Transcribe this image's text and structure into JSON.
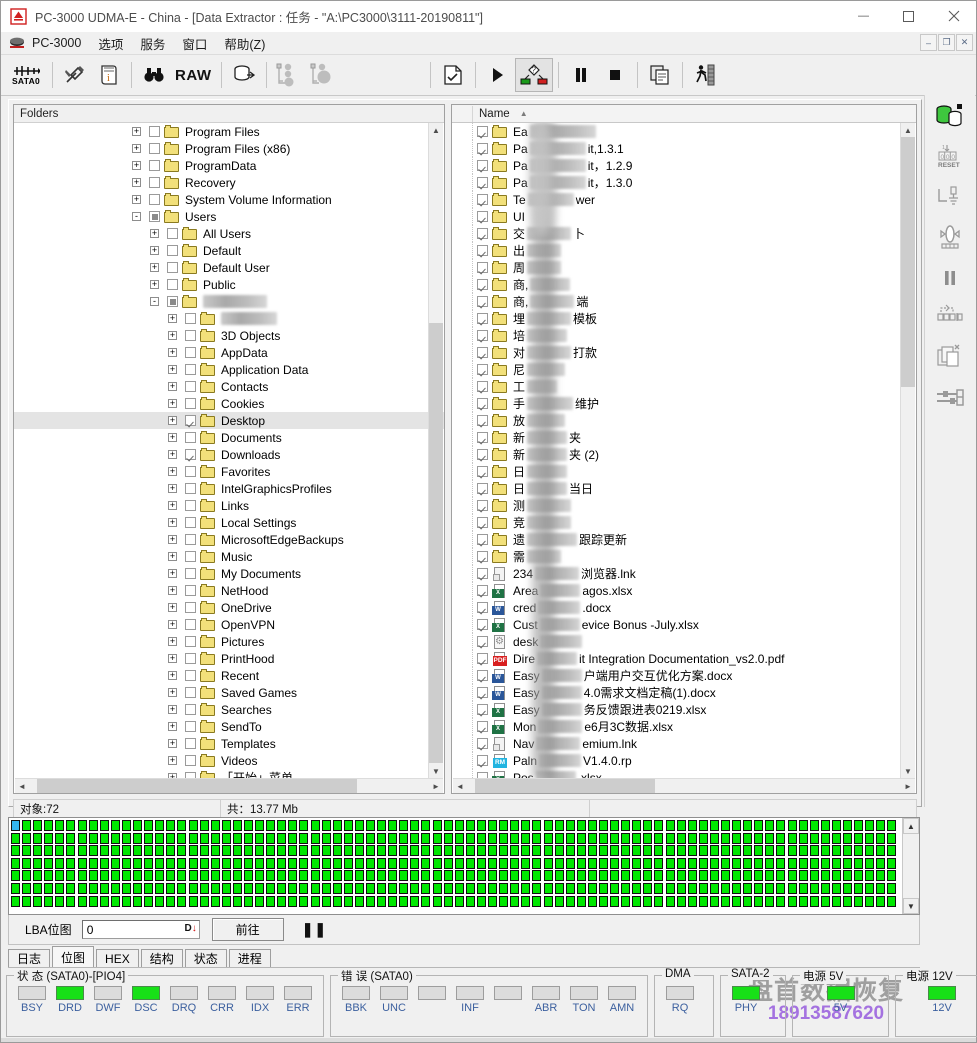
{
  "window": {
    "title": "PC-3000 UDMA-E - China - [Data Extractor : 任务 - \"A:\\PC3000\\3111-20190811\"]",
    "minimize": "—",
    "maximize": "❐",
    "close": "✕"
  },
  "menu": {
    "items": [
      "PC-3000",
      "选项",
      "服务",
      "窗口",
      "帮助(Z)"
    ],
    "mdi": [
      "–",
      "❐",
      "✕"
    ]
  },
  "toolbar": {
    "sata_label": "SATA0",
    "raw_label": "RAW",
    "icons": [
      "sata-port-icon",
      "tools-icon",
      "document-info-icon",
      "binoculars-icon",
      "raw-label",
      "disk-cylinder-icon",
      "task-tree-icon",
      "task-tree-run-icon",
      "file-export-icon",
      "play-icon",
      "map-legend-icon",
      "pause-icon",
      "stop-icon",
      "copy-pages-icon",
      "walking-man-icon"
    ]
  },
  "folders": {
    "header": "Folders",
    "rows": [
      {
        "indent": 0,
        "pm": "+",
        "check": "none",
        "label": "Program Files",
        "blurred": false
      },
      {
        "indent": 0,
        "pm": "+",
        "check": "none",
        "label": "Program Files (x86)",
        "blurred": false
      },
      {
        "indent": 0,
        "pm": "+",
        "check": "none",
        "label": "ProgramData",
        "blurred": false
      },
      {
        "indent": 0,
        "pm": "+",
        "check": "none",
        "label": "Recovery",
        "blurred": false
      },
      {
        "indent": 0,
        "pm": "+",
        "check": "none",
        "label": "System Volume Information",
        "blurred": false
      },
      {
        "indent": 0,
        "pm": "-",
        "check": "part",
        "label": "Users",
        "blurred": false
      },
      {
        "indent": 1,
        "pm": "+",
        "check": "none",
        "label": "All Users",
        "blurred": false
      },
      {
        "indent": 1,
        "pm": "+",
        "check": "none",
        "label": "Default",
        "blurred": false
      },
      {
        "indent": 1,
        "pm": "+",
        "check": "none",
        "label": "Default User",
        "blurred": false
      },
      {
        "indent": 1,
        "pm": "+",
        "check": "none",
        "label": "Public",
        "blurred": false
      },
      {
        "indent": 1,
        "pm": "-",
        "check": "part",
        "label": "",
        "blurred": true,
        "blur_width": 64
      },
      {
        "indent": 2,
        "pm": "+",
        "check": "none",
        "label": ".android",
        "blurred": true,
        "blur_width": 56
      },
      {
        "indent": 2,
        "pm": "+",
        "check": "none",
        "label": "3D Objects",
        "blurred": false
      },
      {
        "indent": 2,
        "pm": "+",
        "check": "none",
        "label": "AppData",
        "blurred": false
      },
      {
        "indent": 2,
        "pm": "+",
        "check": "none",
        "label": "Application Data",
        "blurred": false
      },
      {
        "indent": 2,
        "pm": "+",
        "check": "none",
        "label": "Contacts",
        "blurred": false
      },
      {
        "indent": 2,
        "pm": "+",
        "check": "none",
        "label": "Cookies",
        "blurred": false
      },
      {
        "indent": 2,
        "pm": "+",
        "check": "checked",
        "label": "Desktop",
        "blurred": false,
        "selected": true
      },
      {
        "indent": 2,
        "pm": "+",
        "check": "none",
        "label": "Documents",
        "blurred": false
      },
      {
        "indent": 2,
        "pm": "+",
        "check": "checked",
        "label": "Downloads",
        "blurred": false
      },
      {
        "indent": 2,
        "pm": "+",
        "check": "none",
        "label": "Favorites",
        "blurred": false
      },
      {
        "indent": 2,
        "pm": "+",
        "check": "none",
        "label": "IntelGraphicsProfiles",
        "blurred": false
      },
      {
        "indent": 2,
        "pm": "+",
        "check": "none",
        "label": "Links",
        "blurred": false
      },
      {
        "indent": 2,
        "pm": "+",
        "check": "none",
        "label": "Local Settings",
        "blurred": false
      },
      {
        "indent": 2,
        "pm": "+",
        "check": "none",
        "label": "MicrosoftEdgeBackups",
        "blurred": false
      },
      {
        "indent": 2,
        "pm": "+",
        "check": "none",
        "label": "Music",
        "blurred": false
      },
      {
        "indent": 2,
        "pm": "+",
        "check": "none",
        "label": "My Documents",
        "blurred": false
      },
      {
        "indent": 2,
        "pm": "+",
        "check": "none",
        "label": "NetHood",
        "blurred": false
      },
      {
        "indent": 2,
        "pm": "+",
        "check": "none",
        "label": "OneDrive",
        "blurred": false
      },
      {
        "indent": 2,
        "pm": "+",
        "check": "none",
        "label": "OpenVPN",
        "blurred": false
      },
      {
        "indent": 2,
        "pm": "+",
        "check": "none",
        "label": "Pictures",
        "blurred": false
      },
      {
        "indent": 2,
        "pm": "+",
        "check": "none",
        "label": "PrintHood",
        "blurred": false
      },
      {
        "indent": 2,
        "pm": "+",
        "check": "none",
        "label": "Recent",
        "blurred": false
      },
      {
        "indent": 2,
        "pm": "+",
        "check": "none",
        "label": "Saved Games",
        "blurred": false
      },
      {
        "indent": 2,
        "pm": "+",
        "check": "none",
        "label": "Searches",
        "blurred": false
      },
      {
        "indent": 2,
        "pm": "+",
        "check": "none",
        "label": "SendTo",
        "blurred": false
      },
      {
        "indent": 2,
        "pm": "+",
        "check": "none",
        "label": "Templates",
        "blurred": false
      },
      {
        "indent": 2,
        "pm": "+",
        "check": "none",
        "label": "Videos",
        "blurred": false
      },
      {
        "indent": 2,
        "pm": "+",
        "check": "none",
        "label": "「开始」菜单",
        "blurred": false
      }
    ]
  },
  "filelist": {
    "column_header": "Name",
    "sort_indicator": "▲",
    "rows": [
      {
        "icon": "folder",
        "pre": "Ea",
        "blur": 66,
        "post": ""
      },
      {
        "icon": "folder",
        "pre": "Pa",
        "blur": 56,
        "post": "it,1.3.1"
      },
      {
        "icon": "folder",
        "pre": "Pa",
        "blur": 56,
        "post": "it，1.2.9"
      },
      {
        "icon": "folder",
        "pre": "Pa",
        "blur": 56,
        "post": "it，1.3.0"
      },
      {
        "icon": "folder",
        "pre": "Te",
        "blur": 46,
        "post": "wer"
      },
      {
        "icon": "folder",
        "pre": "UI",
        "blur": 0,
        "post": ""
      },
      {
        "icon": "folder",
        "pre": "交",
        "blur": 44,
        "post": "卜"
      },
      {
        "icon": "folder",
        "pre": "出",
        "blur": 34,
        "post": ""
      },
      {
        "icon": "folder",
        "pre": "周",
        "blur": 34,
        "post": ""
      },
      {
        "icon": "folder",
        "pre": "商,",
        "blur": 40,
        "post": ""
      },
      {
        "icon": "folder",
        "pre": "商,",
        "blur": 44,
        "post": "端"
      },
      {
        "icon": "folder",
        "pre": "埋",
        "blur": 44,
        "post": "模板"
      },
      {
        "icon": "folder",
        "pre": "培",
        "blur": 40,
        "post": ""
      },
      {
        "icon": "folder",
        "pre": "对",
        "blur": 44,
        "post": "打款"
      },
      {
        "icon": "folder",
        "pre": "尼",
        "blur": 38,
        "post": ""
      },
      {
        "icon": "folder",
        "pre": "工",
        "blur": 30,
        "post": ""
      },
      {
        "icon": "folder",
        "pre": "手",
        "blur": 46,
        "post": "维护"
      },
      {
        "icon": "folder",
        "pre": "放",
        "blur": 38,
        "post": ""
      },
      {
        "icon": "folder",
        "pre": "新",
        "blur": 40,
        "post": "夹"
      },
      {
        "icon": "folder",
        "pre": "新",
        "blur": 40,
        "post": "夹 (2)"
      },
      {
        "icon": "folder",
        "pre": "日",
        "blur": 40,
        "post": ""
      },
      {
        "icon": "folder",
        "pre": "日",
        "blur": 40,
        "post": "当日"
      },
      {
        "icon": "folder",
        "pre": "测",
        "blur": 44,
        "post": ""
      },
      {
        "icon": "folder",
        "pre": "竞",
        "blur": 44,
        "post": ""
      },
      {
        "icon": "folder",
        "pre": "遗",
        "blur": 50,
        "post": "跟踪更新"
      },
      {
        "icon": "folder",
        "pre": "需",
        "blur": 34,
        "post": ""
      },
      {
        "icon": "lnk",
        "pre": "234",
        "blur": 44,
        "post": "浏览器.lnk"
      },
      {
        "icon": "xls",
        "pre": "Area",
        "blur": 40,
        "post": "agos.xlsx"
      },
      {
        "icon": "doc",
        "pre": "cred",
        "blur": 42,
        "post": ".docx"
      },
      {
        "icon": "xls",
        "pre": "Cust",
        "blur": 40,
        "post": "evice Bonus -July.xlsx"
      },
      {
        "icon": "gear",
        "pre": "desk",
        "blur": 42,
        "post": ""
      },
      {
        "icon": "pdf",
        "pre": "Dire",
        "blur": 40,
        "post": "it Integration Documentation_vs2.0.pdf"
      },
      {
        "icon": "doc",
        "pre": "Easy",
        "blur": 40,
        "post": "户端用户交互优化方案.docx"
      },
      {
        "icon": "doc",
        "pre": "Easy",
        "blur": 40,
        "post": "4.0需求文档定稿(1).docx"
      },
      {
        "icon": "xls",
        "pre": "Easy",
        "blur": 40,
        "post": "务反馈跟进表0219.xlsx"
      },
      {
        "icon": "xls",
        "pre": "Mon",
        "blur": 44,
        "post": "e6月3C数据.xlsx"
      },
      {
        "icon": "lnk",
        "pre": "Nav",
        "blur": 44,
        "post": "emium.lnk"
      },
      {
        "icon": "rp",
        "pre": "Paln",
        "blur": 42,
        "post": "V1.4.0.rp"
      },
      {
        "icon": "xls",
        "pre": "Pos",
        "blur": 40,
        "post": ".xlsx"
      }
    ]
  },
  "statusstrip": {
    "objects": "对象:72",
    "total": "共：13.77 Mb",
    "third": ""
  },
  "lbamap": {
    "watermark_text": "盘首数据恢复",
    "watermark_phone": "18913587620",
    "cells_total": 560,
    "blue_index": 0,
    "colors": {
      "good": "#00e800",
      "current": "#33b5f0"
    }
  },
  "lbacontrols": {
    "label": "LBA位图",
    "value": "0",
    "placeholder": "0",
    "spin_d": "D",
    "spin_arrow": "↓",
    "go_button": "前往",
    "pause": "❚❚"
  },
  "tabs": {
    "items": [
      "日志",
      "位图",
      "HEX",
      "结构",
      "状态",
      "进程"
    ],
    "active": "位图"
  },
  "righttools": {
    "icons": [
      "disk-green-icon",
      "reset-counter-icon",
      "signal-probe-icon",
      "oscillator-icon",
      "pause-icon",
      "registers-icon",
      "copy-multi-icon",
      "settings-slider-icon"
    ],
    "reset_label": "RESET"
  },
  "bottom": {
    "status_group": {
      "title": "状 态 (SATA0)-[PIO4]",
      "leds": [
        {
          "name": "BSY",
          "on": false
        },
        {
          "name": "DRD",
          "on": true
        },
        {
          "name": "DWF",
          "on": false
        },
        {
          "name": "DSC",
          "on": true
        },
        {
          "name": "DRQ",
          "on": false
        },
        {
          "name": "CRR",
          "on": false
        },
        {
          "name": "IDX",
          "on": false
        },
        {
          "name": "ERR",
          "on": false
        }
      ]
    },
    "error_group": {
      "title": "错 误 (SATA0)",
      "leds": [
        {
          "name": "BBK",
          "on": false
        },
        {
          "name": "UNC",
          "on": false
        },
        {
          "name": "",
          "on": false
        },
        {
          "name": "INF",
          "on": false
        },
        {
          "name": "",
          "on": false
        },
        {
          "name": "ABR",
          "on": false
        },
        {
          "name": "TON",
          "on": false
        },
        {
          "name": "AMN",
          "on": false
        }
      ]
    },
    "dma_group": {
      "title": "DMA",
      "leds": [
        {
          "name": "RQ",
          "on": false
        }
      ]
    },
    "sata2_group": {
      "title": "SATA-2",
      "leds": [
        {
          "name": "PHY",
          "on": true
        }
      ]
    },
    "power5_group": {
      "title": "电源 5V",
      "leds": [
        {
          "name": "5V",
          "on": true
        }
      ]
    },
    "power12_group": {
      "title": "电源 12V",
      "leds": [
        {
          "name": "12V",
          "on": true
        }
      ]
    }
  }
}
